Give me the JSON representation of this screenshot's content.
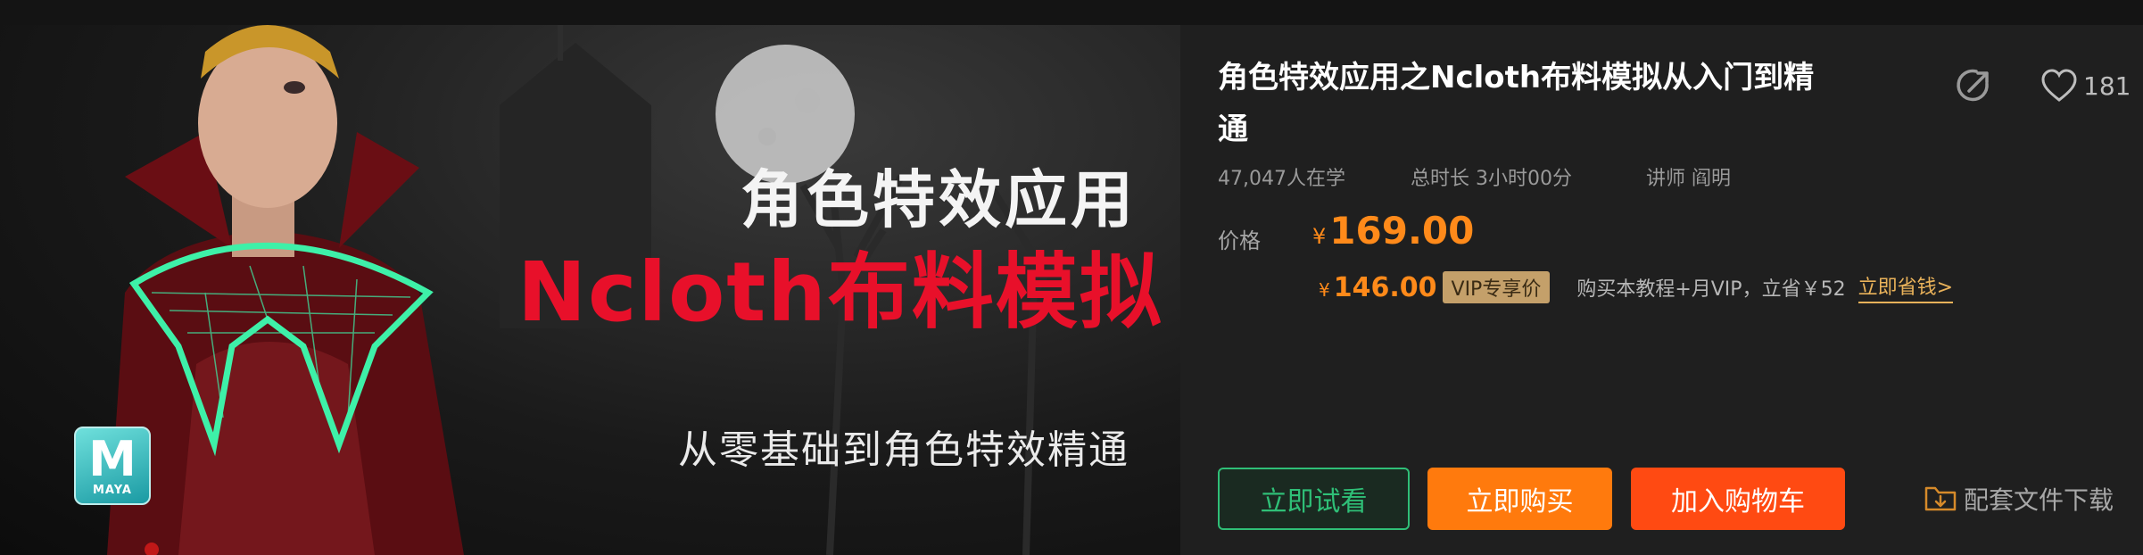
{
  "banner": {
    "title_line1": "角色特效应用",
    "title_line2": "Ncloth布料模拟",
    "subtitle": "从零基础到角色特效精通",
    "logo_text": "MAYA",
    "logo_letter": "M"
  },
  "course": {
    "title": "角色特效应用之Ncloth布料模拟从入门到精通",
    "likes": "181",
    "learners": "47,047人在学",
    "duration": "总时长 3小时00分",
    "teacher": "讲师 阎明"
  },
  "price": {
    "label": "价格",
    "currency": "¥",
    "value": "169.00",
    "vip_value": "146.00",
    "vip_badge": "VIP专享价",
    "vip_note": "购买本教程+月VIP，立省￥52",
    "vip_link": "立即省钱>"
  },
  "actions": {
    "trial": "立即试看",
    "buy": "立即购买",
    "cart": "加入购物车",
    "download": "配套文件下载"
  },
  "icons": {
    "share": "share-icon",
    "like": "heart-icon",
    "download": "folder-download-icon"
  },
  "colors": {
    "accent_orange": "#ff8a1a",
    "buy_orange": "#ff7a0d",
    "cart_red": "#ff4a12",
    "trial_green": "#2fbf77",
    "vip_gold": "#c4a06a",
    "banner_red": "#e8102a"
  }
}
